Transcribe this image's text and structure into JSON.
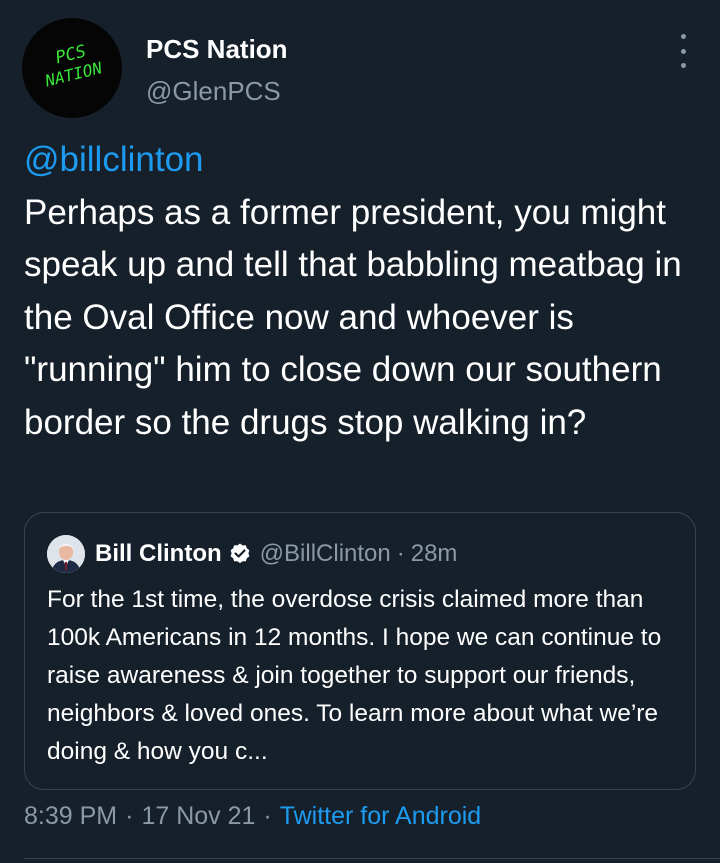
{
  "tweet": {
    "author": {
      "name": "PCS Nation",
      "handle": "@GlenPCS",
      "avatar_text_line1": "PCS",
      "avatar_text_line2": "NATION"
    },
    "mention": "@billclinton",
    "text": "Perhaps as a former president, you might speak up and tell that babbling meatbag in the Oval Office now and whoever is \"running\" him to close down our southern border so the drugs stop walking in?",
    "timestamp": "8:39 PM",
    "date": "17 Nov 21",
    "separator": "·",
    "source": "Twitter for Android"
  },
  "quoted_tweet": {
    "name": "Bill Clinton",
    "handle": "@BillClinton",
    "separator": "·",
    "time": "28m",
    "verified": true,
    "text": "For the 1st time, the overdose crisis claimed more than 100k Americans in 12 months. I hope we can continue to raise awareness & join together to support our friends, neighbors & loved ones. To learn more about what we’re doing & how you c..."
  },
  "colors": {
    "background": "#15202b",
    "link": "#1d9bf0",
    "secondary_text": "#8b98a5",
    "border": "#38444d",
    "avatar_accent": "#39e639"
  },
  "icons": {
    "more": "more-vertical-icon",
    "verified": "verified-badge-icon"
  }
}
